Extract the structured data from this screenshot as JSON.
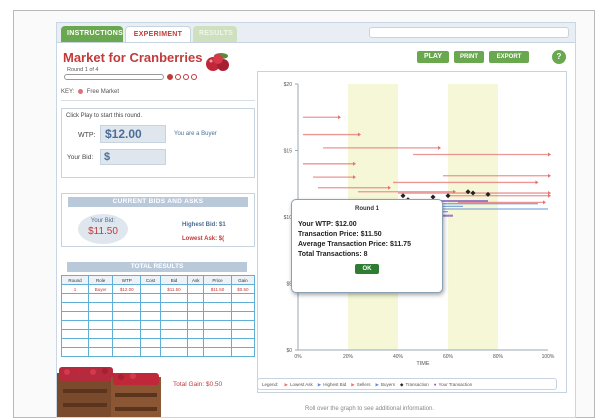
{
  "tabs": [
    {
      "label": "INSTRUCTIONS"
    },
    {
      "label": "EXPERIMENT"
    },
    {
      "label": "RESULTS"
    }
  ],
  "header": {
    "title": "Market for Cranberries",
    "round": "Round 1 of 4",
    "rounds_total": 4,
    "rounds_completed": 1
  },
  "key": {
    "label": "KEY:",
    "item": "Free Market"
  },
  "play_panel": {
    "instruction": "Click Play to start this round.",
    "wtp_label": "WTP:",
    "wtp_value": "$12.00",
    "role": "You are a Buyer",
    "bid_label": "Your Bid:",
    "bid_value": "$"
  },
  "bids_panel": {
    "title": "CURRENT BIDS AND ASKS",
    "your_bid_label": "Your Bid:",
    "your_bid_value": "$11.50",
    "highest_bid": "Highest Bid: $1",
    "lowest_ask": "Lowest Ask: $("
  },
  "results": {
    "title": "TOTAL RESULTS",
    "columns": [
      "Round",
      "Role",
      "WTP",
      "Cost",
      "Bid",
      "Ask",
      "Price",
      "Gain"
    ],
    "rows": [
      [
        "1",
        "Buyer",
        "$12.00",
        "",
        "$11.50",
        "",
        "$11.50",
        "$0.50"
      ],
      [
        "",
        "",
        "",
        "",
        "",
        "",
        "",
        ""
      ],
      [
        "",
        "",
        "",
        "",
        "",
        "",
        "",
        ""
      ],
      [
        "",
        "",
        "",
        "",
        "",
        "",
        "",
        ""
      ],
      [
        "",
        "",
        "",
        "",
        "",
        "",
        "",
        ""
      ],
      [
        "",
        "",
        "",
        "",
        "",
        "",
        "",
        ""
      ],
      [
        "",
        "",
        "",
        "",
        "",
        "",
        "",
        ""
      ],
      [
        "",
        "",
        "",
        "",
        "",
        "",
        "",
        ""
      ]
    ],
    "total_gain": "Total Gain: $0.50"
  },
  "buttons": {
    "play": "PLAY",
    "print": "PRINT",
    "export": "EXPORT",
    "help": "?"
  },
  "chart_data": {
    "type": "line",
    "y_ticks": [
      "$20",
      "$15",
      "$10",
      "$5",
      "$0"
    ],
    "y_values": [
      20,
      15,
      10,
      5,
      0
    ],
    "x_ticks": [
      "0%",
      "20%",
      "40%",
      "60%",
      "80%",
      "100%"
    ],
    "xlabel": "TIME",
    "ylim": [
      0,
      20
    ],
    "xlim": [
      0,
      100
    ],
    "grid": false,
    "highlight_bands": [
      [
        20,
        40
      ],
      [
        60,
        80
      ]
    ],
    "colors": {
      "ask": "#e57373",
      "bid": "#5c8fd6",
      "seller": "#e57373",
      "buyer": "#5c8fd6",
      "transaction": "#222222",
      "your_transaction": "#7e57c2"
    },
    "series": [
      {
        "type": "ask",
        "segments": [
          [
            2,
            16,
            17.5
          ],
          [
            2,
            24,
            16.2
          ],
          [
            2,
            22,
            14.0
          ],
          [
            6,
            22,
            13.0
          ],
          [
            8,
            36,
            12.2
          ],
          [
            24,
            62,
            11.9
          ],
          [
            40,
            100,
            11.8
          ],
          [
            58,
            100,
            13.1
          ],
          [
            38,
            95,
            12.6
          ],
          [
            46,
            100,
            14.7
          ],
          [
            10,
            56,
            15.2
          ],
          [
            60,
            100,
            11.6
          ],
          [
            64,
            98,
            11.1
          ]
        ]
      },
      {
        "type": "bid",
        "segments": [
          [
            2,
            30,
            8.8
          ],
          [
            2,
            26,
            7.7
          ],
          [
            2,
            34,
            7.2
          ],
          [
            4,
            30,
            8.2
          ],
          [
            2,
            40,
            9.2
          ],
          [
            6,
            40,
            9.6
          ],
          [
            30,
            60,
            10.4
          ],
          [
            38,
            66,
            10.8
          ],
          [
            42,
            96,
            11.0
          ],
          [
            2,
            24,
            10.0
          ],
          [
            56,
            100,
            10.6
          ]
        ]
      },
      {
        "type": "your_bid",
        "segments": [
          [
            38,
            62,
            10.1
          ],
          [
            50,
            76,
            11.2
          ]
        ]
      }
    ],
    "transactions": [
      {
        "x": 42,
        "y": 11.6
      },
      {
        "x": 44,
        "y": 11.3
      },
      {
        "x": 50,
        "y": 11.0
      },
      {
        "x": 54,
        "y": 11.5
      },
      {
        "x": 60,
        "y": 11.6
      },
      {
        "x": 68,
        "y": 11.9
      },
      {
        "x": 70,
        "y": 11.8
      },
      {
        "x": 76,
        "y": 11.7
      }
    ]
  },
  "legend": [
    {
      "label": "Lowest Ask",
      "mark": "▶"
    },
    {
      "label": "Highest Bid",
      "mark": "▶"
    },
    {
      "label": "Sellers",
      "mark": "▶"
    },
    {
      "label": "Buyers",
      "mark": "▶"
    },
    {
      "label": "Transaction",
      "mark": "◆"
    },
    {
      "label": "Your Transaction",
      "mark": "●"
    }
  ],
  "legend_label": "Legend:",
  "rollover": "Roll over the graph to see additional information.",
  "popup": {
    "title": "Round 1",
    "wtp": "Your WTP: $12.00",
    "transaction_price": "Transaction Price: $11.50",
    "average_price": "Average Transaction Price: $11.75",
    "total_transactions": "Total Transactions: 8",
    "ok": "OK"
  }
}
